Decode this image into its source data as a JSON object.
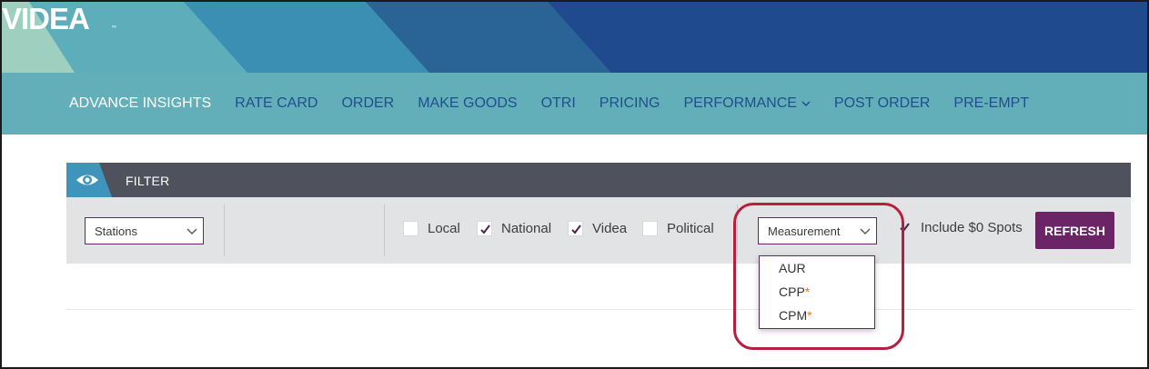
{
  "brand": {
    "logo_text": "VIDEA"
  },
  "nav": {
    "items": [
      {
        "label": "ADVANCE INSIGHTS",
        "active": true
      },
      {
        "label": "RATE CARD"
      },
      {
        "label": "ORDER"
      },
      {
        "label": "MAKE GOODS"
      },
      {
        "label": "OTRI"
      },
      {
        "label": "PRICING"
      },
      {
        "label": "PERFORMANCE",
        "has_dropdown": true
      },
      {
        "label": "POST ORDER"
      },
      {
        "label": "PRE-EMPT"
      }
    ]
  },
  "filter": {
    "title": "FILTER",
    "stations_select": "Stations",
    "checkboxes": [
      {
        "label": "Local",
        "checked": false
      },
      {
        "label": "National",
        "checked": true
      },
      {
        "label": "Videa",
        "checked": true
      },
      {
        "label": "Political",
        "checked": false
      }
    ],
    "measurement_select": "Measurement",
    "include_zero": {
      "label": "Include $0 Spots",
      "checked": true
    },
    "refresh_label": "REFRESH"
  },
  "measurement_dropdown": {
    "options": [
      {
        "label": "AUR",
        "star": ""
      },
      {
        "label": "CPP",
        "star": "*"
      },
      {
        "label": "CPM",
        "star": "*"
      }
    ]
  },
  "colors": {
    "nav_bg": "#63afb9",
    "nav_text": "#1f4f8c",
    "filter_head": "#4f525c",
    "accent_purple": "#6b2466",
    "highlight": "#b81f3f",
    "asterisk": "#e07a1a"
  }
}
